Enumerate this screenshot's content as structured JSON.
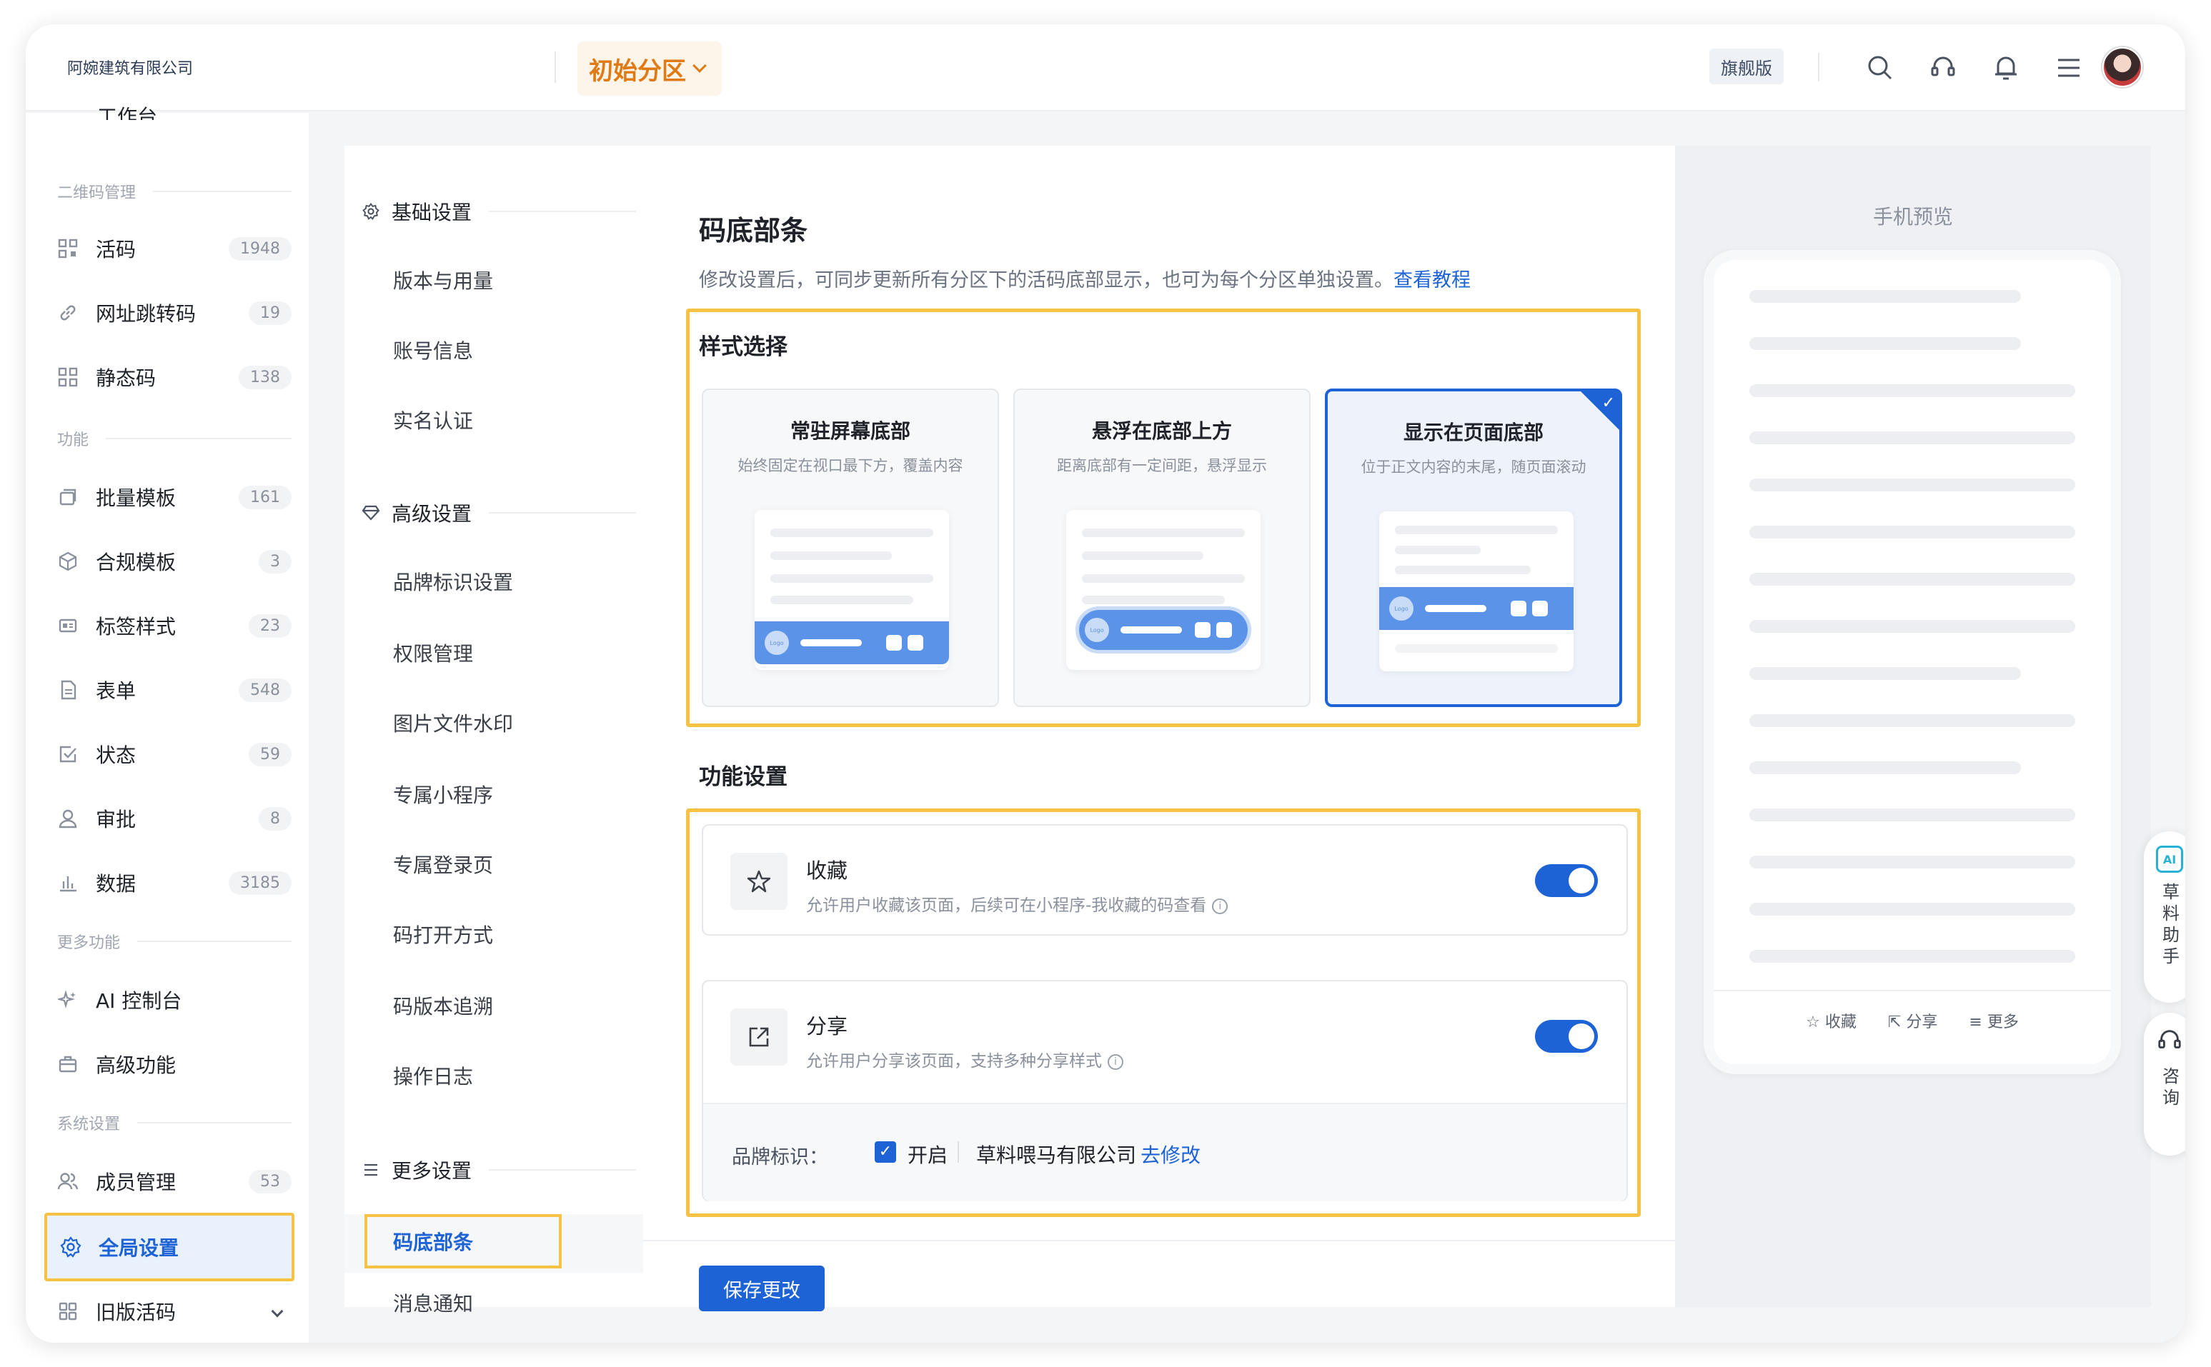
{
  "header": {
    "company": "阿婉建筑有限公司",
    "region": "初始分区",
    "edition_badge": "旗舰版",
    "icons": [
      "search-icon",
      "headset-icon",
      "bell-icon",
      "menu-icon"
    ]
  },
  "sidebar": {
    "partial_top": "工作台",
    "sections": [
      "二维码管理",
      "功能",
      "更多功能",
      "系统设置"
    ],
    "items": [
      {
        "label": "活码",
        "count": "1948",
        "icon": "qrcode-icon"
      },
      {
        "label": "网址跳转码",
        "count": "19",
        "icon": "link-icon"
      },
      {
        "label": "静态码",
        "count": "138",
        "icon": "qrcode-static-icon"
      },
      {
        "label": "批量模板",
        "count": "161",
        "icon": "batch-template-icon"
      },
      {
        "label": "合规模板",
        "count": "3",
        "icon": "cube-icon"
      },
      {
        "label": "标签样式",
        "count": "23",
        "icon": "label-icon"
      },
      {
        "label": "表单",
        "count": "548",
        "icon": "form-icon"
      },
      {
        "label": "状态",
        "count": "59",
        "icon": "status-check-icon"
      },
      {
        "label": "审批",
        "count": "8",
        "icon": "approval-user-icon"
      },
      {
        "label": "数据",
        "count": "3185",
        "icon": "bar-chart-icon"
      },
      {
        "label": "AI 控制台",
        "count": "",
        "icon": "ai-sparkle-icon"
      },
      {
        "label": "高级功能",
        "count": "",
        "icon": "briefcase-icon"
      },
      {
        "label": "成员管理",
        "count": "53",
        "icon": "members-icon"
      },
      {
        "label": "全局设置",
        "count": "",
        "icon": "gear-icon"
      },
      {
        "label": "旧版活码",
        "count": "",
        "icon": "grid-icon"
      }
    ]
  },
  "settings_nav": {
    "groups": [
      {
        "label": "基础设置",
        "icon": "gear-icon",
        "items": [
          "版本与用量",
          "账号信息",
          "实名认证"
        ]
      },
      {
        "label": "高级设置",
        "icon": "diamond-icon",
        "items": [
          "品牌标识设置",
          "权限管理",
          "图片文件水印",
          "专属小程序",
          "专属登录页",
          "码打开方式",
          "码版本追溯",
          "操作日志"
        ]
      },
      {
        "label": "更多设置",
        "icon": "list-icon",
        "items": [
          "码底部条",
          "消息通知"
        ]
      }
    ]
  },
  "main": {
    "title": "码底部条",
    "desc": "修改设置后，可同步更新所有分区下的活码底部显示，也可为每个分区单独设置。",
    "desc_link": "查看教程",
    "style_section": "样式选择",
    "styles": [
      {
        "title": "常驻屏幕底部",
        "desc": "始终固定在视口最下方，覆盖内容",
        "selected": false
      },
      {
        "title": "悬浮在底部上方",
        "desc": "距离底部有一定间距，悬浮显示",
        "selected": false
      },
      {
        "title": "显示在页面底部",
        "desc": "位于正文内容的末尾，随页面滚动",
        "selected": true
      }
    ],
    "logo_text": "Logo",
    "func_section": "功能设置",
    "features": [
      {
        "title": "收藏",
        "desc": "允许用户收藏该页面，后续可在小程序-我收藏的码查看",
        "enabled": true,
        "icon": "star-icon"
      },
      {
        "title": "分享",
        "desc": "允许用户分享该页面，支持多种分享样式",
        "enabled": true,
        "icon": "share-icon"
      }
    ],
    "brand": {
      "label": "品牌标识：",
      "checkbox": "开启",
      "company": "草料喂马有限公司",
      "edit": "去修改"
    },
    "save": "保存更改"
  },
  "preview": {
    "title": "手机预览",
    "toolbar": [
      "收藏",
      "分享",
      "更多"
    ]
  },
  "floating": {
    "ai_badge": "AI",
    "assistant": "草料助手",
    "consult": "咨询"
  },
  "colors": {
    "primary": "#1e63d6",
    "accent_orange": "#e07a14",
    "highlight": "#f6c243"
  }
}
